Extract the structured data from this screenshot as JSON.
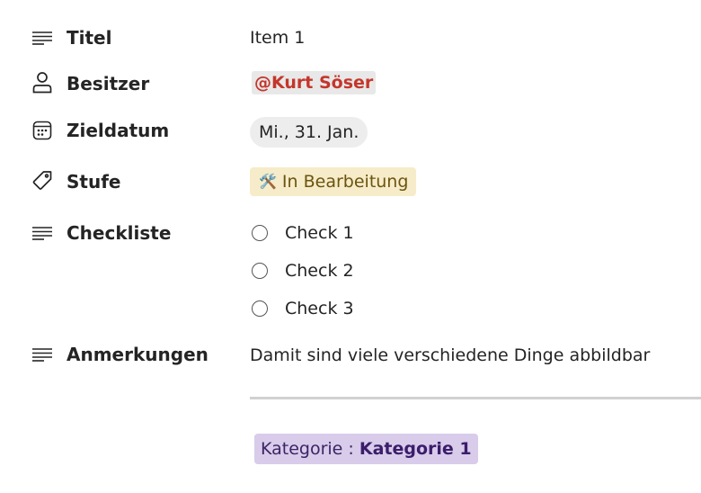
{
  "fields": {
    "title": {
      "label": "Titel",
      "value": "Item 1",
      "icon": "lines-icon"
    },
    "owner": {
      "label": "Besitzer",
      "value": "@Kurt Söser",
      "icon": "person-icon"
    },
    "due_date": {
      "label": "Zieldatum",
      "value": "Mi., 31. Jan.",
      "icon": "calendar-icon"
    },
    "stage": {
      "label": "Stufe",
      "value": "In Bearbeitung",
      "emoji": "🛠️",
      "icon": "tag-icon"
    },
    "checklist": {
      "label": "Checkliste",
      "icon": "lines-icon",
      "items": [
        {
          "text": "Check 1",
          "checked": false
        },
        {
          "text": "Check 2",
          "checked": false
        },
        {
          "text": "Check 3",
          "checked": false
        }
      ]
    },
    "notes": {
      "label": "Anmerkungen",
      "value": "Damit sind viele verschiedene Dinge abbildbar",
      "icon": "lines-icon"
    }
  },
  "category": {
    "prefix": "Kategorie : ",
    "name": "Kategorie 1"
  },
  "colors": {
    "mention_text": "#c4362b",
    "stage_background": "#f7ecc9",
    "category_background": "#d8ccea"
  }
}
